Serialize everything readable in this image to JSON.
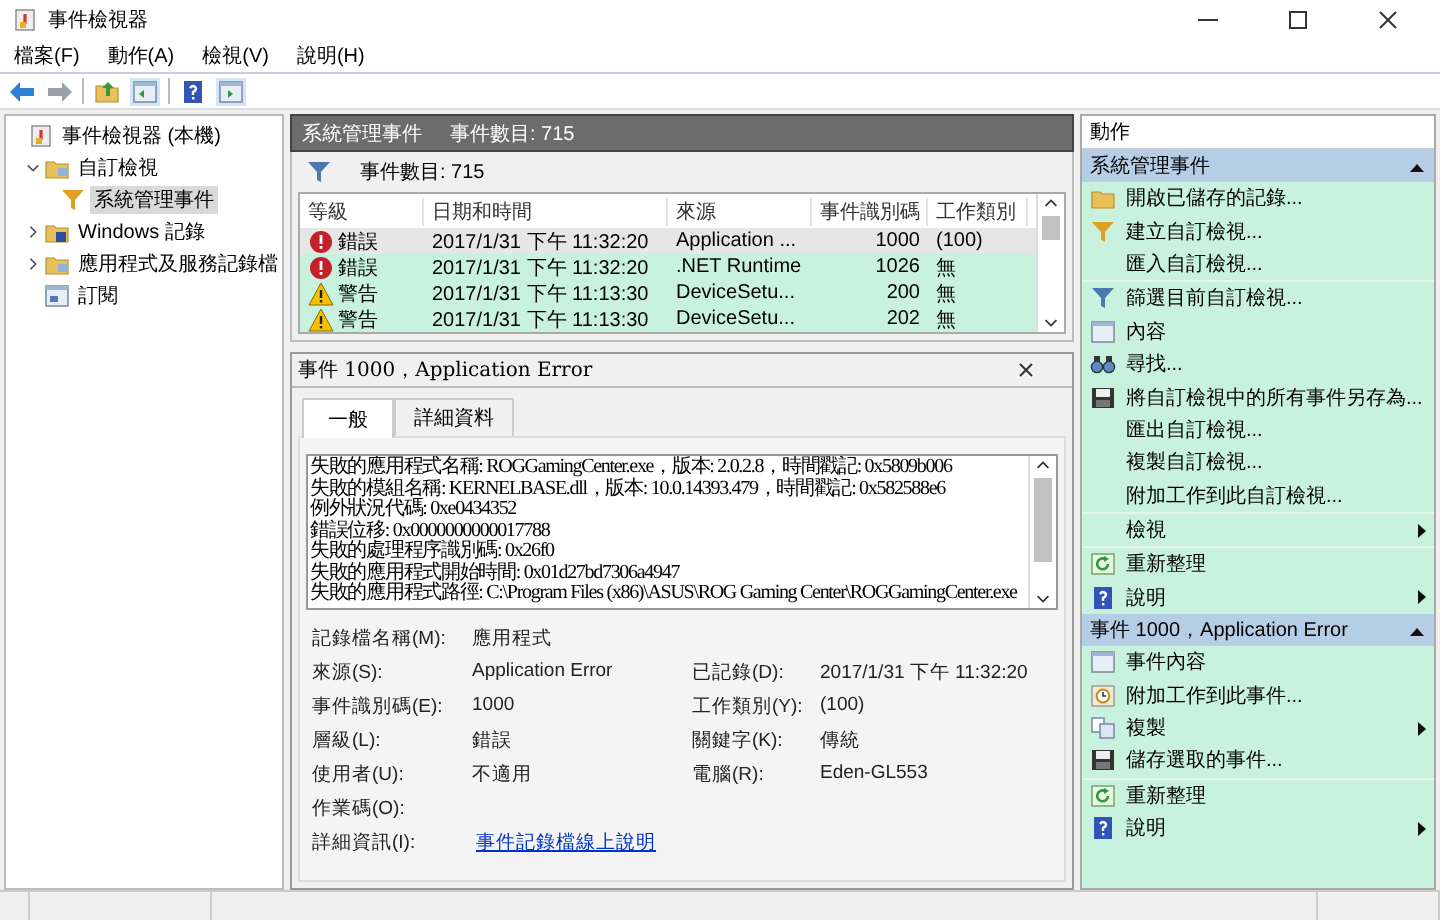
{
  "window": {
    "title": "事件檢視器"
  },
  "menu": [
    "檔案(F)",
    "動作(A)",
    "檢視(V)",
    "說明(H)"
  ],
  "tree": [
    {
      "label": "事件檢視器 (本機)",
      "kind": "root",
      "selected": false,
      "children": [
        {
          "label": "自訂檢視",
          "kind": "folder",
          "expanded": true,
          "selected": false,
          "children": [
            {
              "label": "系統管理事件",
              "kind": "view",
              "selected": true
            }
          ]
        },
        {
          "label": "Windows 記錄",
          "kind": "log",
          "expanded": false,
          "selected": false
        },
        {
          "label": "應用程式及服務記錄檔",
          "kind": "folder",
          "expanded": false,
          "selected": false
        },
        {
          "label": "訂閱",
          "kind": "subscription",
          "selected": false
        }
      ]
    }
  ],
  "center": {
    "title": "系統管理事件",
    "count": "事件數目: 715",
    "filter_count": "事件數目: 715",
    "table": {
      "columns": [
        "等級",
        "日期和時間",
        "來源",
        "事件識別碼",
        "工作類別"
      ],
      "rows": [
        {
          "kind": "error",
          "level": "錯誤",
          "date": "2017/1/31 下午 11:32:20",
          "source": "Application ...",
          "id": "1000",
          "task": "(100)",
          "selected": true
        },
        {
          "kind": "error",
          "level": "錯誤",
          "date": "2017/1/31 下午 11:32:20",
          "source": ".NET Runtime",
          "id": "1026",
          "task": "無",
          "selected": false
        },
        {
          "kind": "warning",
          "level": "警告",
          "date": "2017/1/31 下午 11:13:30",
          "source": "DeviceSetu...",
          "id": "200",
          "task": "無",
          "selected": false
        },
        {
          "kind": "warning",
          "level": "警告",
          "date": "2017/1/31 下午 11:13:30",
          "source": "DeviceSetu...",
          "id": "202",
          "task": "無",
          "selected": false
        }
      ]
    }
  },
  "detail": {
    "title": "事件 1000，Application Error",
    "tabs": [
      {
        "label": "一般",
        "selected": true
      },
      {
        "label": "詳細資料",
        "selected": false
      }
    ],
    "message": [
      "失敗的應用程式名稱: ROGGamingCenter.exe，版本: 2.0.2.8，時間戳記: 0x5809b006",
      "失敗的模組名稱: KERNELBASE.dll，版本: 10.0.14393.479，時間戳記: 0x582588e6",
      "例外狀況代碼: 0xe0434352",
      "錯誤位移: 0x0000000000017788",
      "失敗的處理程序識別碼: 0x26f0",
      "失敗的應用程式開始時間: 0x01d27bd7306a4947",
      "失敗的應用程式路徑: C:\\Program Files (x86)\\ASUS\\ROG Gaming Center\\ROGGamingCenter.exe"
    ],
    "fields": [
      [
        {
          "label": "記錄檔名稱(M):",
          "value": "應用程式"
        }
      ],
      [
        {
          "label": "來源(S):",
          "value": "Application Error"
        },
        {
          "label": "已記錄(D):",
          "value": "2017/1/31 下午 11:32:20"
        }
      ],
      [
        {
          "label": "事件識別碼(E):",
          "value": "1000"
        },
        {
          "label": "工作類別(Y):",
          "value": "(100)"
        }
      ],
      [
        {
          "label": "層級(L):",
          "value": "錯誤"
        },
        {
          "label": "關鍵字(K):",
          "value": "傳統"
        }
      ],
      [
        {
          "label": "使用者(U):",
          "value": "不適用"
        },
        {
          "label": "電腦(R):",
          "value": "Eden-GL553"
        }
      ],
      [
        {
          "label": "作業碼(O):"
        }
      ],
      [
        {
          "label": "詳細資訊(I):",
          "value": "事件記錄檔線上說明",
          "kind": "link"
        }
      ]
    ]
  },
  "actions": {
    "title": "動作",
    "sections": [
      {
        "title": "系統管理事件",
        "expanded": true,
        "items": [
          {
            "label": "開啟已儲存的記錄..."
          },
          {
            "label": "建立自訂檢視..."
          },
          {
            "label": "匯入自訂檢視..."
          },
          {
            "label": "篩選目前自訂檢視...",
            "separator": true
          },
          {
            "label": "內容"
          },
          {
            "label": "尋找..."
          },
          {
            "label": "將自訂檢視中的所有事件另存為..."
          },
          {
            "label": "匯出自訂檢視..."
          },
          {
            "label": "複製自訂檢視..."
          },
          {
            "label": "附加工作到此自訂檢視..."
          },
          {
            "label": "檢視",
            "submenu": true,
            "separator": true
          },
          {
            "label": "重新整理",
            "separator": true
          },
          {
            "label": "說明",
            "submenu": true
          }
        ]
      },
      {
        "title": "事件 1000，Application Error",
        "expanded": true,
        "items": [
          {
            "label": "事件內容"
          },
          {
            "label": "附加工作到此事件..."
          },
          {
            "label": "複製",
            "submenu": true
          },
          {
            "label": "儲存選取的事件..."
          },
          {
            "label": "重新整理",
            "separator": true
          },
          {
            "label": "說明",
            "submenu": true
          }
        ]
      }
    ]
  }
}
